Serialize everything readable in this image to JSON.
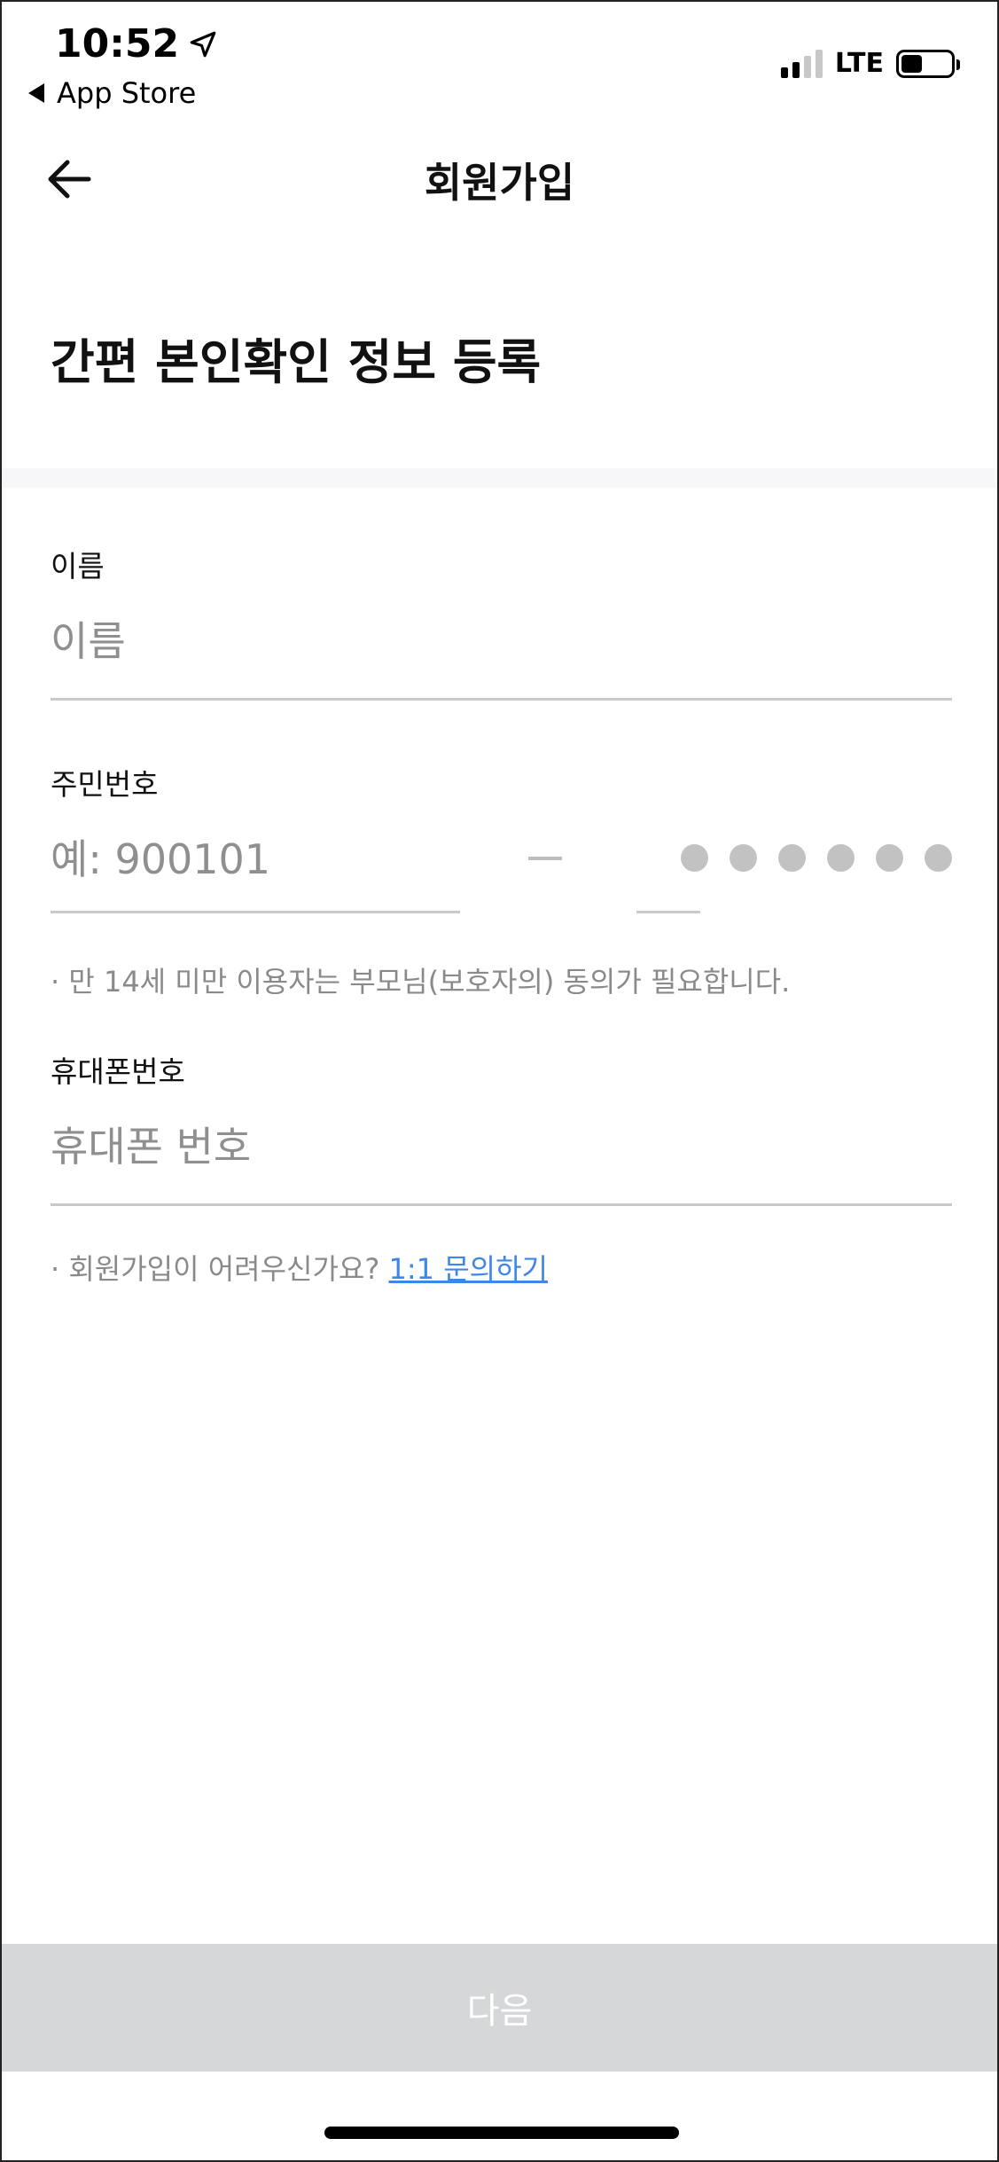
{
  "status_bar": {
    "time": "10:52",
    "back_app": "App Store",
    "network": "LTE",
    "signal_bars_active": 2,
    "signal_bars_total": 4,
    "battery_level_fraction": 0.42
  },
  "header": {
    "title": "회원가입",
    "back_icon": "arrow-left-icon"
  },
  "section": {
    "title": "간편 본인확인 정보 등록"
  },
  "form": {
    "name": {
      "label": "이름",
      "placeholder": "이름",
      "value": ""
    },
    "resident_number": {
      "label": "주민번호",
      "front_placeholder": "예: 900101",
      "front_value": "",
      "back_masked_digits": 6,
      "note": "· 만 14세 미만 이용자는 부모님(보호자의) 동의가 필요합니다."
    },
    "phone": {
      "label": "휴대폰번호",
      "placeholder": "휴대폰 번호",
      "value": ""
    },
    "help": {
      "text": "· 회원가입이 어려우신가요? ",
      "link_label": "1:1 문의하기"
    }
  },
  "footer": {
    "next_label": "다음"
  },
  "colors": {
    "link": "#3f86e6",
    "button_disabled_bg": "#d6d7d9",
    "placeholder": "#8f8f8f",
    "underline": "#c9c9c9"
  }
}
